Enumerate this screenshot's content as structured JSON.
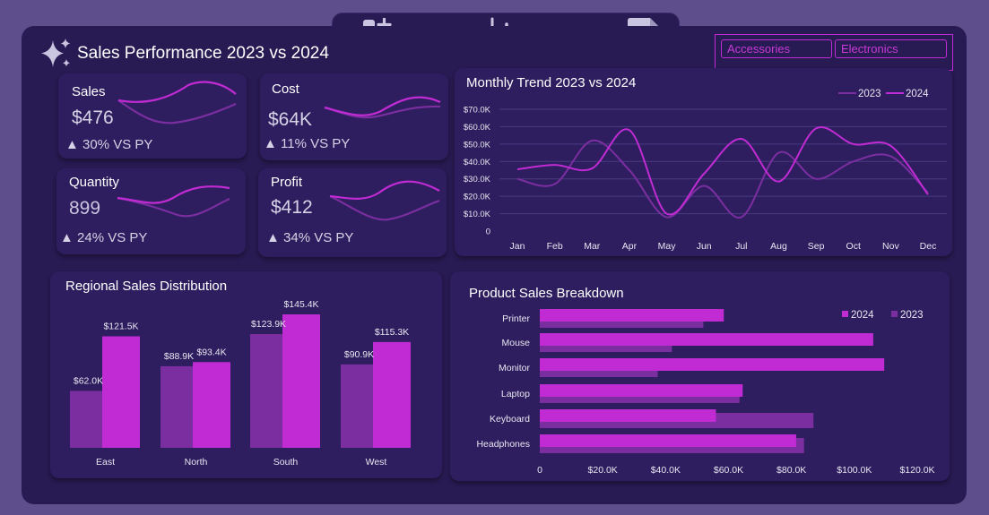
{
  "header": {
    "title": "Sales Performance 2023 vs 2024",
    "nav_icons": [
      "dashboard-add-icon",
      "bar-chart-icon",
      "document-icon"
    ]
  },
  "slicer": {
    "items": [
      "Accessories",
      "Electronics"
    ]
  },
  "colors": {
    "accent": "#c12bd3",
    "y2023": "#7b2ea0",
    "panel": "#2e1e5f",
    "background": "#281a52"
  },
  "kpis": [
    {
      "label": "Sales",
      "value": "$476",
      "change": "30% VS PY"
    },
    {
      "label": "Cost",
      "value": "$64K",
      "change": "11% VS PY"
    },
    {
      "label": "Quantity",
      "value": "899",
      "change": "24% VS PY"
    },
    {
      "label": "Profit",
      "value": "$412",
      "change": "34% VS PY"
    }
  ],
  "chart_data": [
    {
      "type": "line",
      "title": "Monthly Trend 2023 vs 2024",
      "categories": [
        "Jan",
        "Feb",
        "Mar",
        "Apr",
        "May",
        "Jun",
        "Jul",
        "Aug",
        "Sep",
        "Oct",
        "Nov",
        "Dec"
      ],
      "series": [
        {
          "name": "2023",
          "values": [
            30000,
            27000,
            52000,
            35000,
            8000,
            26000,
            8000,
            45000,
            30000,
            40000,
            43000,
            22000
          ]
        },
        {
          "name": "2024",
          "values": [
            35500,
            38000,
            36000,
            58000,
            10000,
            33000,
            53000,
            28500,
            59000,
            50000,
            49000,
            21000
          ]
        }
      ],
      "ylim": [
        0,
        70000
      ],
      "yticks": [
        "0",
        "$10.0K",
        "$20.0K",
        "$30.0K",
        "$40.0K",
        "$50.0K",
        "$60.0K",
        "$70.0K"
      ],
      "legend": "top-right",
      "grid": true
    },
    {
      "type": "bar",
      "title": "Regional Sales Distribution",
      "categories": [
        "East",
        "North",
        "South",
        "West"
      ],
      "series": [
        {
          "name": "2023",
          "values": [
            62000,
            88900,
            123900,
            90900
          ],
          "labels": [
            "$62.0K",
            "$88.9K",
            "$123.9K",
            "$90.9K"
          ]
        },
        {
          "name": "2024",
          "values": [
            121500,
            93400,
            145400,
            115300
          ],
          "labels": [
            "$121.5K",
            "$93.4K",
            "$145.4K",
            "$115.3K"
          ]
        }
      ]
    },
    {
      "type": "bar",
      "orientation": "horizontal",
      "title": "Product Sales Breakdown",
      "categories": [
        "Printer",
        "Mouse",
        "Monitor",
        "Laptop",
        "Keyboard",
        "Headphones"
      ],
      "series": [
        {
          "name": "2024",
          "values": [
            58500,
            106000,
            109500,
            64500,
            56000,
            81500
          ]
        },
        {
          "name": "2023",
          "values": [
            52000,
            42000,
            37500,
            63500,
            87000,
            84000
          ]
        }
      ],
      "xlim": [
        0,
        120000
      ],
      "xticks": [
        "0",
        "$20.0K",
        "$40.0K",
        "$60.0K",
        "$80.0K",
        "$100.0K",
        "$120.0K"
      ],
      "legend": "top-right"
    }
  ]
}
